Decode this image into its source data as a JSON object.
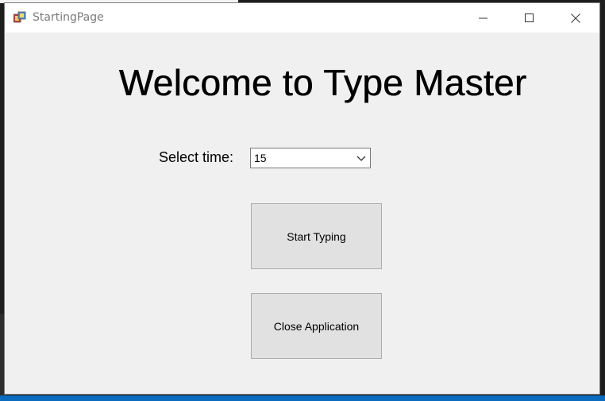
{
  "window": {
    "title": "StartingPage",
    "app_icon": "winforms-app-icon"
  },
  "main": {
    "heading": "Welcome to Type Master",
    "time_label": "Select time:",
    "time_value": "15",
    "start_button": "Start Typing",
    "close_button": "Close Application"
  },
  "colors": {
    "window_bg": "#f0f0f0",
    "button_bg": "#e1e1e1",
    "title_text": "#7b7b7b"
  }
}
